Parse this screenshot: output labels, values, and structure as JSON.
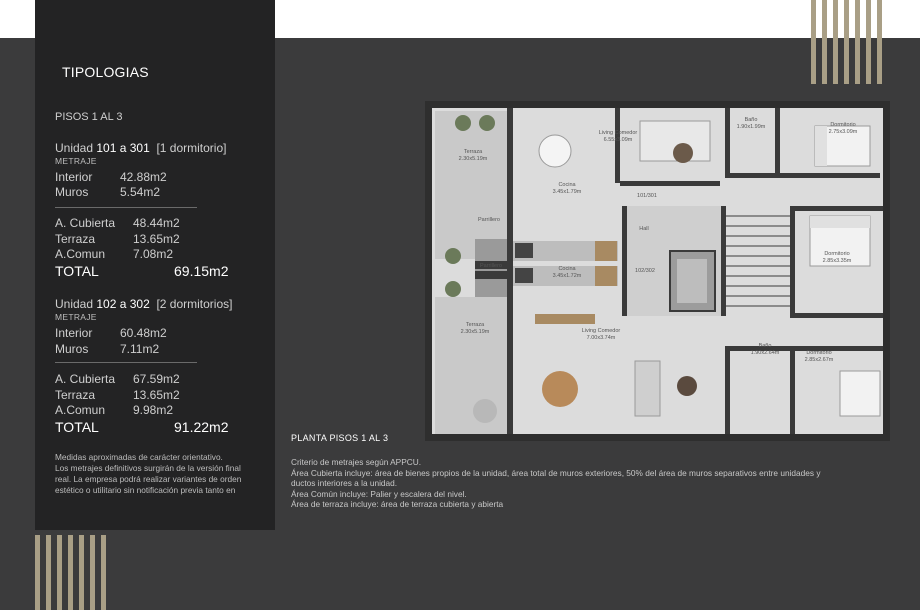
{
  "header": {
    "title": "TIPOLOGIAS",
    "floors": "PISOS 1 AL 3"
  },
  "units": [
    {
      "prefix": "Unidad ",
      "number": "101 a 301",
      "type": "[1 dormitorio]",
      "metraje_label": "METRAJE",
      "interior_label": "Interior",
      "interior_value": "42.88m2",
      "muros_label": "Muros",
      "muros_value": "5.54m2",
      "cubierta_label": "A. Cubierta",
      "cubierta_value": "48.44m2",
      "terraza_label": "Terraza",
      "terraza_value": "13.65m2",
      "comun_label": "A.Comun",
      "comun_value": "7.08m2",
      "total_label": "TOTAL",
      "total_value": "69.15m2"
    },
    {
      "prefix": "Unidad ",
      "number": "102 a 302",
      "type": "[2 dormitorios]",
      "metraje_label": "METRAJE",
      "interior_label": "Interior",
      "interior_value": "60.48m2",
      "muros_label": "Muros",
      "muros_value": "7.11m2",
      "cubierta_label": "A. Cubierta",
      "cubierta_value": "67.59m2",
      "terraza_label": "Terraza",
      "terraza_value": "13.65m2",
      "comun_label": "A.Comun",
      "comun_value": "9.98m2",
      "total_label": "TOTAL",
      "total_value": "91.22m2"
    }
  ],
  "disclaimer": [
    "Medidas aproximadas de carácter orientativo.",
    "Los metrajes definitivos surgirán de la versión final",
    "real. La empresa podrá realizar variantes de orden",
    "estético o utilitario sin notificación previa tanto en"
  ],
  "plan": {
    "caption": "PLANTA PISOS 1 AL 3",
    "rooms": {
      "terraza_top": [
        "Terraza",
        "2.30x5.19m"
      ],
      "living_top": [
        "Living Comedor",
        "6.55x3.09m"
      ],
      "bano_top": [
        "Baño",
        "1.90x1.99m"
      ],
      "dorm_top": [
        "Dormitorio",
        "2.75x3.09m"
      ],
      "cocina_top": [
        "Cocina",
        "3.45x1.79m"
      ],
      "unit_101": "101/301",
      "parrillero_top": "Parrillero",
      "hall": "Hall",
      "unit_102": "102/302",
      "dorm_mid": [
        "Dormitorio",
        "2.85x3.35m"
      ],
      "parrillero_bottom": "Parrillero",
      "cocina_bottom": [
        "Cocina",
        "3.45x1.72m"
      ],
      "terraza_bottom": [
        "Terraza",
        "2.30x5.19m"
      ],
      "living_bottom": [
        "Living Comedor",
        "7.00x3.74m"
      ],
      "bano_bottom": [
        "Baño",
        "1.90x2.64m"
      ],
      "dorm_bottom": [
        "Dormitorio",
        "2.85x2.67m"
      ]
    }
  },
  "criteria": [
    "Criterio de metrajes según APPCU.",
    "Área Cubierta incluye: área de bienes propios de la unidad, área total de muros exteriores, 50% del área de muros separativos entre unidades y",
    "ductos interiores a la unidad.",
    "Área Común incluye: Palier y escalera del nivel.",
    "Área de terraza incluye: área de terraza cubierta y abierta"
  ],
  "colors": {
    "background": "#3b3b3c",
    "panel": "#232324",
    "accent_gold": "#a99f86",
    "white": "#ffffff"
  }
}
